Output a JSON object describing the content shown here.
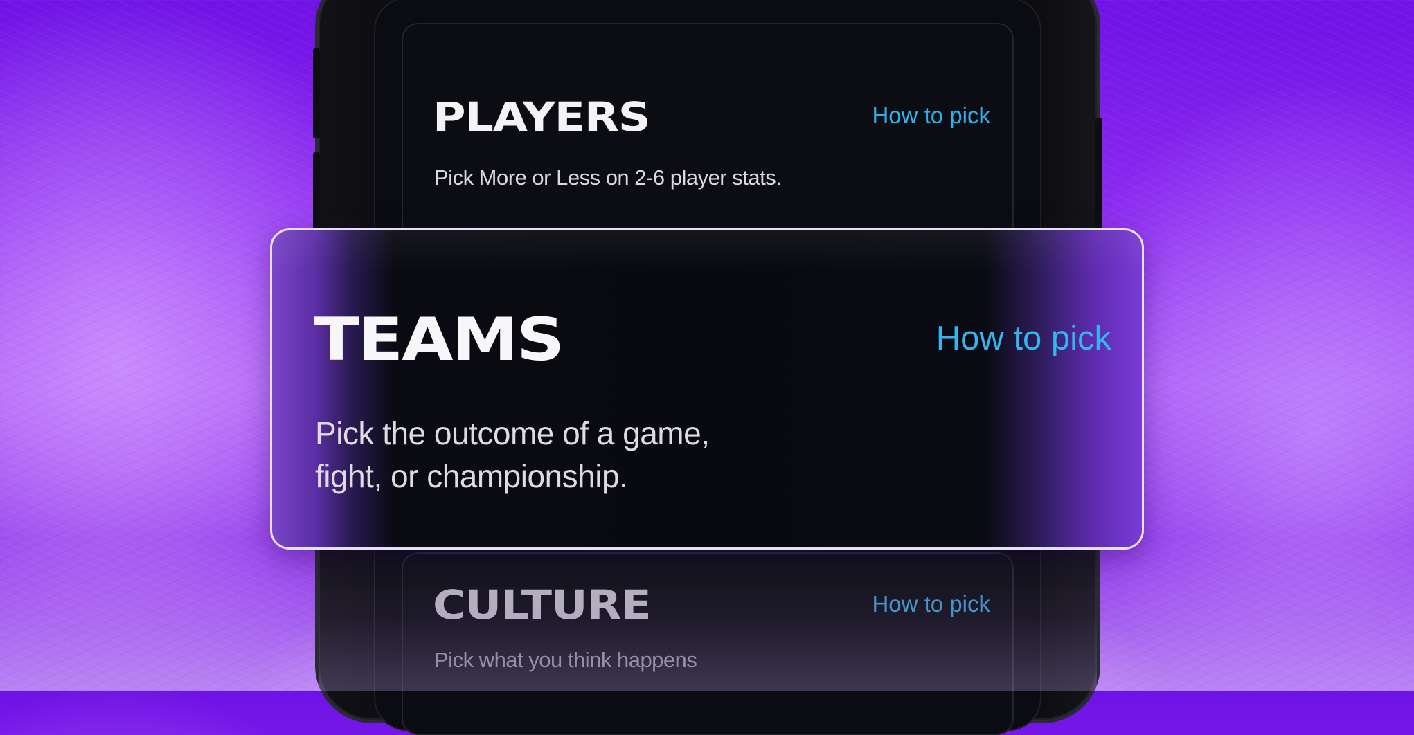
{
  "cards": {
    "players": {
      "title": "PLAYERS",
      "link": "How to pick",
      "description": "Pick More or Less on 2-6 player stats."
    },
    "teams": {
      "title": "TEAMS",
      "link": "How to pick",
      "description_line1": "Pick the outcome of a game,",
      "description_line2": "fight, or championship."
    },
    "culture": {
      "title": "CULTURE",
      "link": "How to pick",
      "description": "Pick what you think happens"
    }
  },
  "colors": {
    "background_primary": "#8d2cf1",
    "background_highlight": "#d096ff",
    "card_background": "#0c0d12",
    "link_accent": "#2fb0ea",
    "title_text": "#f4f4f6"
  }
}
